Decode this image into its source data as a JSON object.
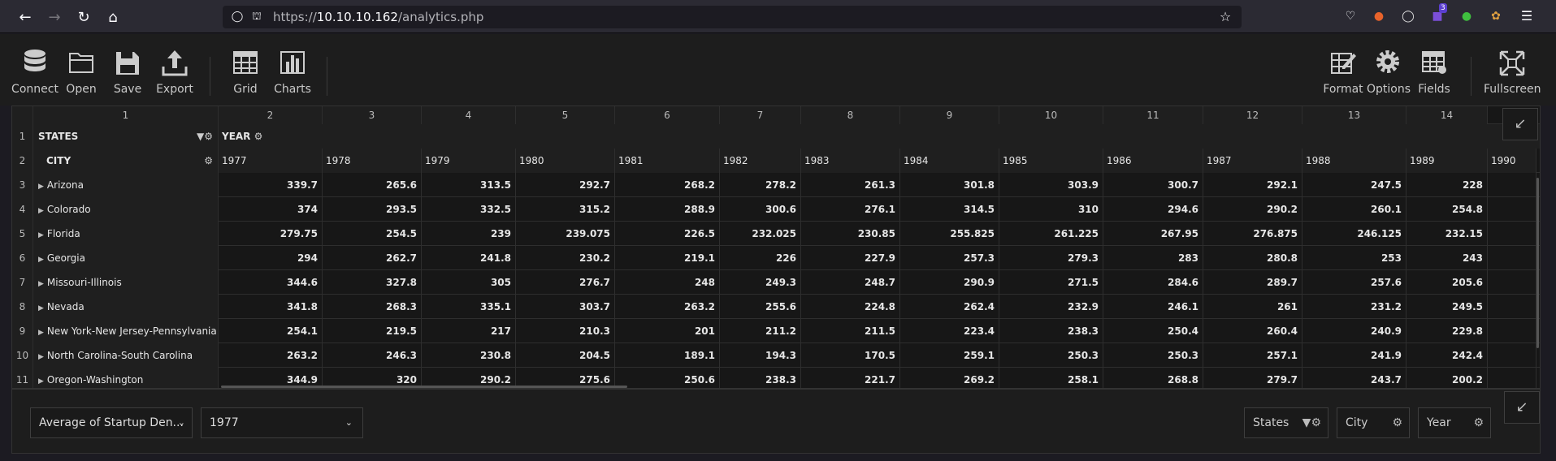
{
  "browser": {
    "url_prefix": "https://",
    "url_host": "10.10.10.162",
    "url_path": "/analytics.php",
    "extension_badge": "3"
  },
  "toolbar": {
    "connect": "Connect",
    "open": "Open",
    "save": "Save",
    "export": "Export",
    "grid": "Grid",
    "charts": "Charts",
    "format": "Format",
    "options": "Options",
    "fields": "Fields",
    "fullscreen": "Fullscreen"
  },
  "grid": {
    "column_numbers": [
      "1",
      "2",
      "3",
      "4",
      "5",
      "6",
      "7",
      "8",
      "9",
      "10",
      "11",
      "12",
      "13",
      "14"
    ],
    "states_header": "STATES",
    "year_header": "YEAR",
    "city_header": "CITY",
    "years": [
      "1977",
      "1978",
      "1979",
      "1980",
      "1981",
      "1982",
      "1983",
      "1984",
      "1985",
      "1986",
      "1987",
      "1988",
      "1989",
      "1990"
    ],
    "rows": [
      {
        "n": "3",
        "label": "Arizona",
        "values": [
          "339.7",
          "265.6",
          "313.5",
          "292.7",
          "268.2",
          "278.2",
          "261.3",
          "301.8",
          "303.9",
          "300.7",
          "292.1",
          "247.5",
          "228"
        ]
      },
      {
        "n": "4",
        "label": "Colorado",
        "values": [
          "374",
          "293.5",
          "332.5",
          "315.2",
          "288.9",
          "300.6",
          "276.1",
          "314.5",
          "310",
          "294.6",
          "290.2",
          "260.1",
          "254.8"
        ]
      },
      {
        "n": "5",
        "label": "Florida",
        "values": [
          "279.75",
          "254.5",
          "239",
          "239.075",
          "226.5",
          "232.025",
          "230.85",
          "255.825",
          "261.225",
          "267.95",
          "276.875",
          "246.125",
          "232.15"
        ]
      },
      {
        "n": "6",
        "label": "Georgia",
        "values": [
          "294",
          "262.7",
          "241.8",
          "230.2",
          "219.1",
          "226",
          "227.9",
          "257.3",
          "279.3",
          "283",
          "280.8",
          "253",
          "243"
        ]
      },
      {
        "n": "7",
        "label": "Missouri-Illinois",
        "values": [
          "344.6",
          "327.8",
          "305",
          "276.7",
          "248",
          "249.3",
          "248.7",
          "290.9",
          "271.5",
          "284.6",
          "289.7",
          "257.6",
          "205.6"
        ]
      },
      {
        "n": "8",
        "label": "Nevada",
        "values": [
          "341.8",
          "268.3",
          "335.1",
          "303.7",
          "263.2",
          "255.6",
          "224.8",
          "262.4",
          "232.9",
          "246.1",
          "261",
          "231.2",
          "249.5"
        ]
      },
      {
        "n": "9",
        "label": "New York-New Jersey-Pennsylvania",
        "values": [
          "254.1",
          "219.5",
          "217",
          "210.3",
          "201",
          "211.2",
          "211.5",
          "223.4",
          "238.3",
          "250.4",
          "260.4",
          "240.9",
          "229.8"
        ]
      },
      {
        "n": "10",
        "label": "North Carolina-South Carolina",
        "values": [
          "263.2",
          "246.3",
          "230.8",
          "204.5",
          "189.1",
          "194.3",
          "170.5",
          "259.1",
          "250.3",
          "250.3",
          "257.1",
          "241.9",
          "242.4"
        ]
      },
      {
        "n": "11",
        "label": "Oregon-Washington",
        "values": [
          "344.9",
          "320",
          "290.2",
          "275.6",
          "250.6",
          "238.3",
          "221.7",
          "269.2",
          "258.1",
          "268.8",
          "279.7",
          "243.7",
          "200.2"
        ]
      }
    ]
  },
  "bottom": {
    "measure": "Average of Startup Den...",
    "year_filter": "1977",
    "chip_states": "States",
    "chip_city": "City",
    "chip_year": "Year"
  }
}
